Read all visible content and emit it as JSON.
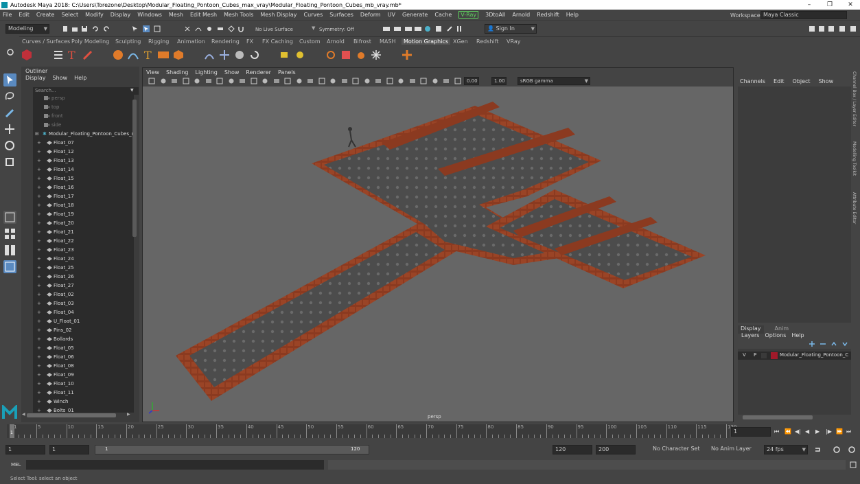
{
  "window": {
    "title": "Autodesk Maya 2018: C:\\Users\\Torezone\\Desktop\\Modular_Floating_Pontoon_Cubes_max_vray\\Modular_Floating_Pontoon_Cubes_mb_vray.mb*",
    "minimize": "–",
    "maximize": "❐",
    "close": "✕"
  },
  "menubar": {
    "items": [
      "File",
      "Edit",
      "Create",
      "Select",
      "Modify",
      "Display",
      "Windows",
      "Mesh",
      "Edit Mesh",
      "Mesh Tools",
      "Mesh Display",
      "Curves",
      "Surfaces",
      "Deform",
      "UV",
      "Generate",
      "Cache",
      "V-Ray",
      "3DtoAll",
      "Arnold",
      "Redshift",
      "Help"
    ],
    "workspace_label": "Workspace :",
    "workspace_value": "Maya Classic"
  },
  "statusline": {
    "mode": "Modeling",
    "live_surface": "No Live Surface",
    "symmetry": "Symmetry: Off",
    "sign_in": "Sign In"
  },
  "shelf": {
    "tabs": [
      "Curves / Surfaces",
      "Poly Modeling",
      "Sculpting",
      "Rigging",
      "Animation",
      "Rendering",
      "FX",
      "FX Caching",
      "Custom",
      "Arnold",
      "Bifrost",
      "MASH",
      "Motion Graphics",
      "XGen",
      "Redshift",
      "VRay"
    ],
    "active_tab": "Motion Graphics",
    "colors": {
      "accent": "#e07b2a",
      "light_blue": "#7ab8e8"
    }
  },
  "outliner": {
    "title": "Outliner",
    "menu": [
      "Display",
      "Show",
      "Help"
    ],
    "search_placeholder": "Search...",
    "cameras": [
      "persp",
      "top",
      "front",
      "side"
    ],
    "root_node": "Modular_Floating_Pontoon_Cubes_n",
    "items": [
      "Float_07",
      "Float_12",
      "Float_13",
      "Float_14",
      "Float_15",
      "Float_16",
      "Float_17",
      "Float_18",
      "Float_19",
      "Float_20",
      "Float_21",
      "Float_22",
      "Float_23",
      "Float_24",
      "Float_25",
      "Float_26",
      "Float_27",
      "Float_02",
      "Float_03",
      "Float_04",
      "U_Float_01",
      "Pins_02",
      "Bollards",
      "Float_05",
      "Float_06",
      "Float_08",
      "Float_09",
      "Float_10",
      "Float_11",
      "Winch",
      "Bolts_01"
    ]
  },
  "viewport": {
    "menu": [
      "View",
      "Shading",
      "Lighting",
      "Show",
      "Renderer",
      "Panels"
    ],
    "exposure": "0.00",
    "gamma": "1.00",
    "color_space": "sRGB gamma",
    "camera_label": "persp",
    "colors": {
      "background": "#666666",
      "deck": "#4a4a4a",
      "float_edge": "#8b3a20"
    }
  },
  "channel_box": {
    "menu": [
      "Channels",
      "Edit",
      "Object",
      "Show"
    ],
    "layer_tabs": [
      "Display",
      "Anim"
    ],
    "active_layer_tab": "Display",
    "layer_menu": [
      "Layers",
      "Options",
      "Help"
    ],
    "layer_row": {
      "v": "V",
      "p": "P",
      "name": "Modular_Floating_Pontoon_C",
      "color": "#a01a2a"
    }
  },
  "side_tabs": [
    "Channel Box / Layer Editor",
    "Modelling Toolkit",
    "Attribute Editor"
  ],
  "timeline": {
    "ticks": [
      "1",
      "5",
      "10",
      "15",
      "20",
      "25",
      "30",
      "35",
      "40",
      "45",
      "50",
      "55",
      "60",
      "65",
      "70",
      "75",
      "80",
      "85",
      "90",
      "95",
      "100",
      "105",
      "110",
      "115",
      "120"
    ],
    "current_frame": "1",
    "current_frame_marker": "1"
  },
  "range": {
    "start": "1",
    "anim_start": "1",
    "slider_start": "1",
    "slider_end": "120",
    "end": "120",
    "anim_end": "200",
    "character_set": "No Character Set",
    "anim_layer": "No Anim Layer",
    "fps": "24 fps"
  },
  "command_line": {
    "label": "MEL"
  },
  "help_line": "Select Tool: select an object"
}
